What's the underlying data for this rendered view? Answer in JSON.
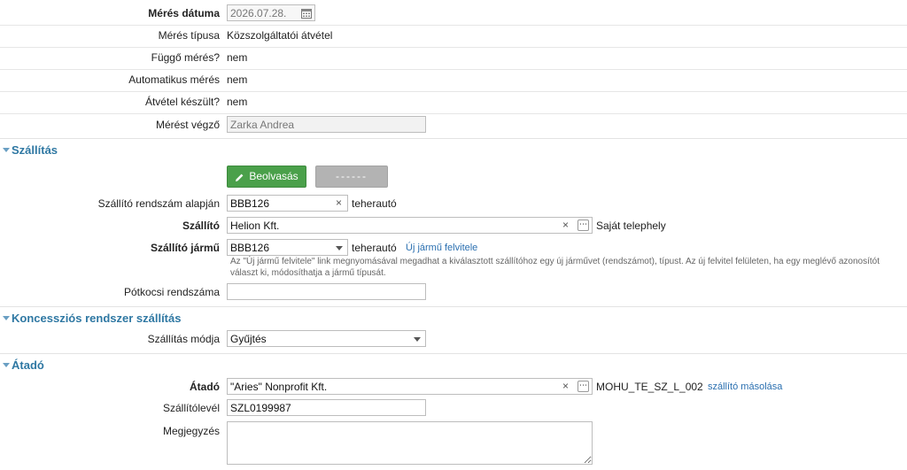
{
  "measurement": {
    "date_label": "Mérés dátuma",
    "date_value": "2026.07.28.",
    "type_label": "Mérés típusa",
    "type_value": "Közszolgáltatói átvétel",
    "pending_label": "Függő mérés?",
    "pending_value": "nem",
    "auto_label": "Automatikus mérés",
    "auto_value": "nem",
    "handover_label": "Átvétel készült?",
    "handover_value": "nem",
    "performer_label": "Mérést végző",
    "performer_value": "Zarka Andrea"
  },
  "shipping": {
    "section_title": "Szállítás",
    "scan_button": "Beolvasás",
    "disabled_button": "------",
    "plate_label": "Szállító rendszám alapján",
    "plate_value": "BBB126",
    "plate_suffix": "teherautó",
    "carrier_label": "Szállító",
    "carrier_value": "Helion Kft.",
    "carrier_suffix": "Saját telephely",
    "vehicle_label": "Szállító jármű",
    "vehicle_value": "BBB126",
    "vehicle_suffix": "teherautó",
    "new_vehicle_link": "Új jármű felvitele",
    "hint": "Az \"Új jármű felvitele\" link megnyomásával megadhat a kiválasztott szállítóhoz egy új járművet (rendszámot), típust. Az új felvitel felületen, ha egy meglévő azonosítót választ ki, módosíthatja a jármű típusát.",
    "trailer_label": "Pótkocsi rendszáma",
    "trailer_value": ""
  },
  "concession": {
    "section_title": "Koncessziós rendszer szállítás",
    "mode_label": "Szállítás módja",
    "mode_value": "Gyűjtés"
  },
  "handover": {
    "section_title": "Átadó",
    "giver_label": "Átadó",
    "giver_value": "\"Aries\" Nonprofit Kft.",
    "giver_code": "MOHU_TE_SZ_L_002",
    "copy_link": "szállító másolása",
    "waybill_label": "Szállítólevél",
    "waybill_value": "SZL0199987",
    "note_label": "Megjegyzés",
    "note_value": ""
  },
  "icons": {
    "calendar": "calendar-icon",
    "pencil": "pencil-icon",
    "clear": "×",
    "browse": "⋯"
  }
}
